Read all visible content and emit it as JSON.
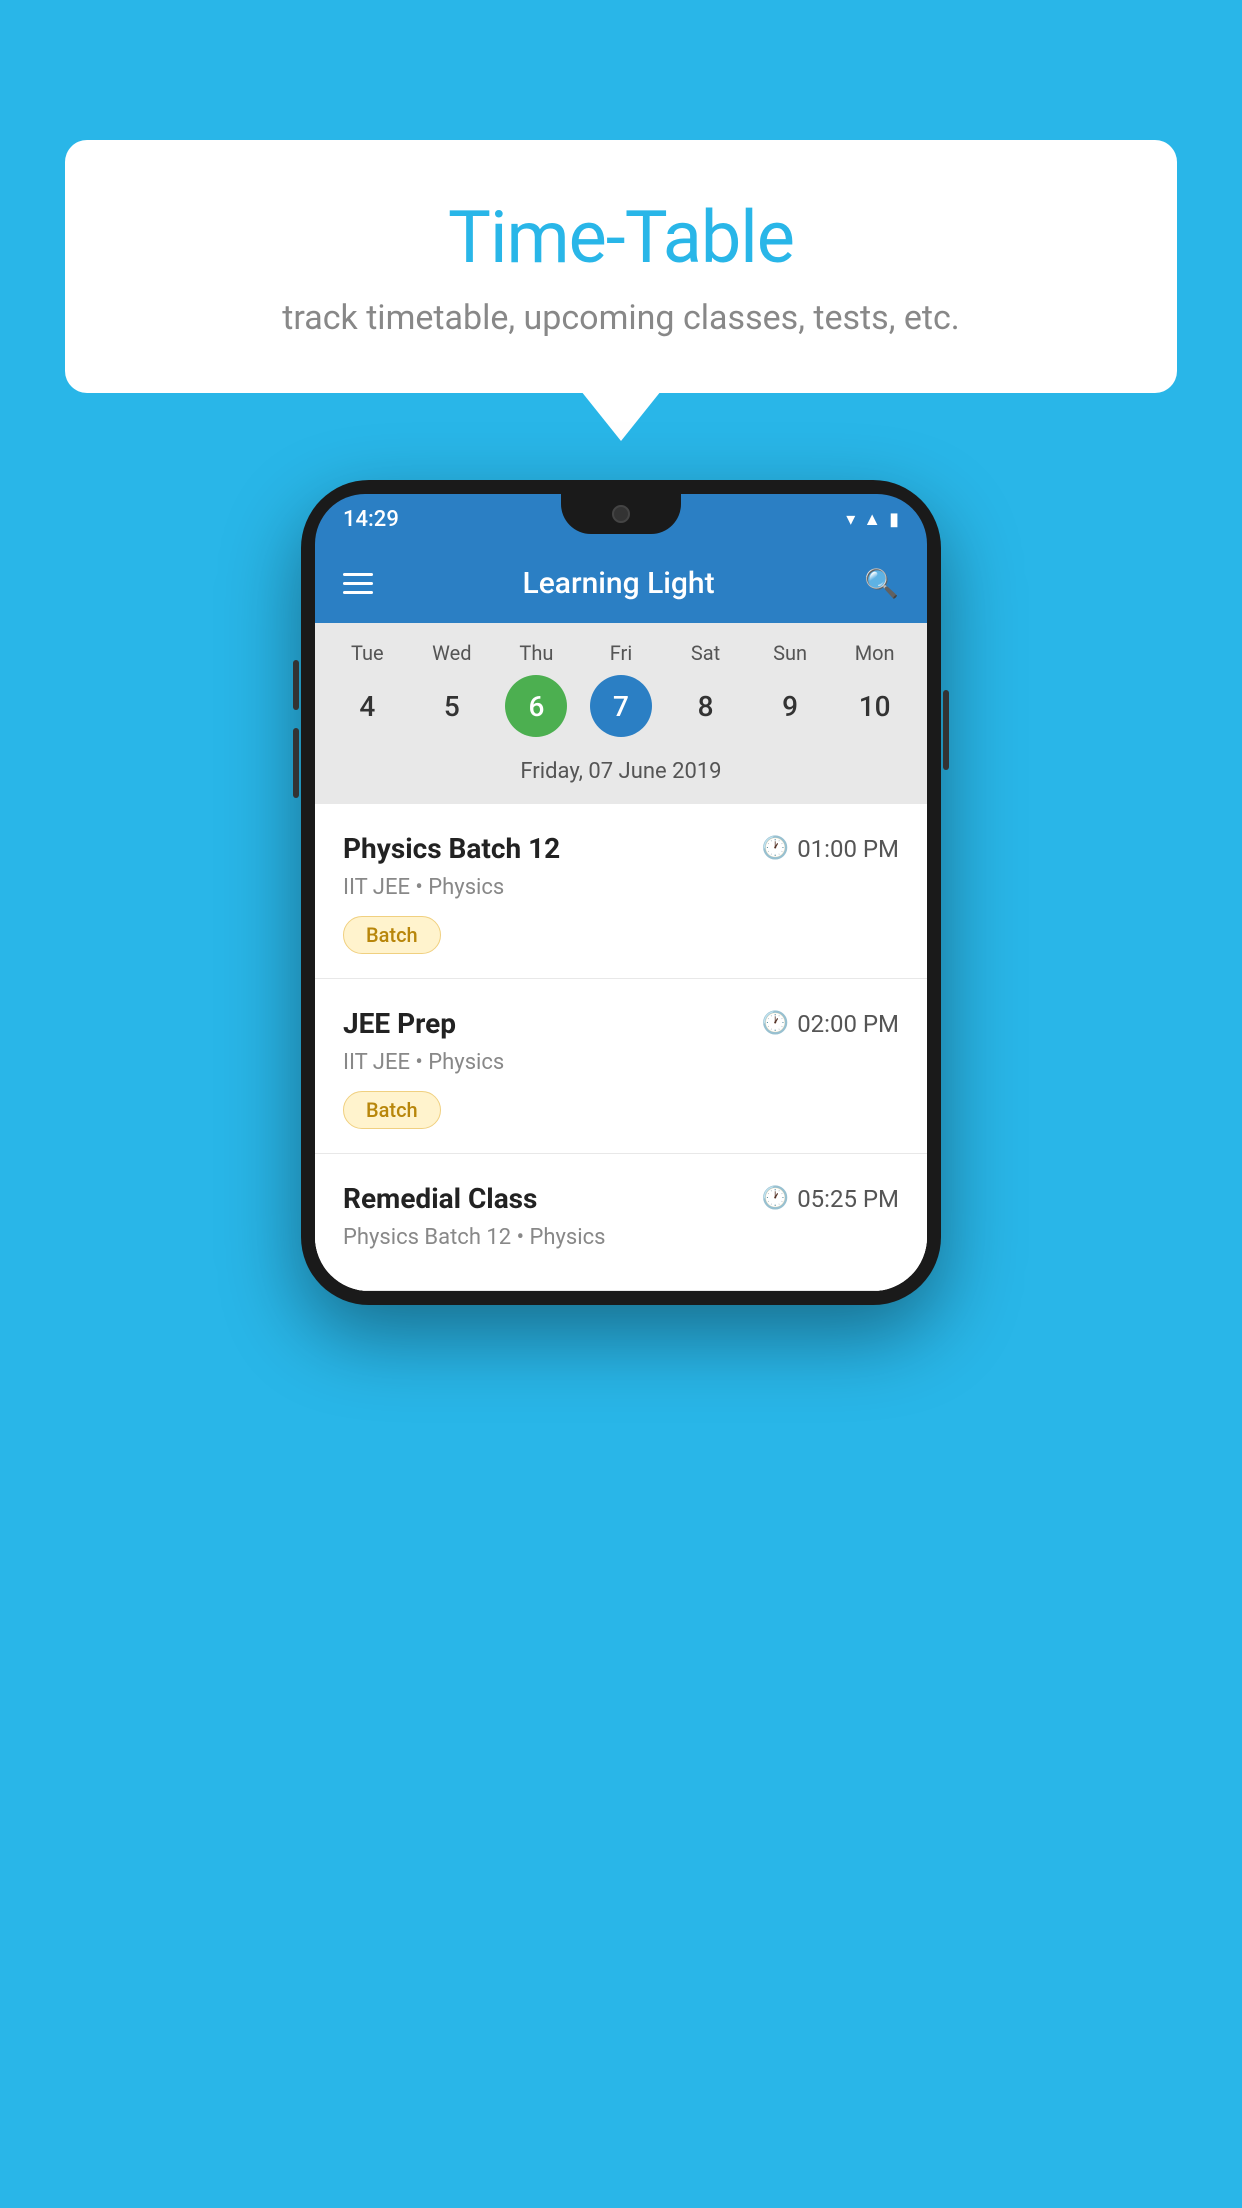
{
  "background_color": "#29b6e8",
  "speech_bubble": {
    "title": "Time-Table",
    "subtitle": "track timetable, upcoming classes, tests, etc."
  },
  "phone": {
    "status_bar": {
      "time": "14:29",
      "icons": [
        "wifi",
        "signal",
        "battery"
      ]
    },
    "app_header": {
      "title": "Learning Light"
    },
    "calendar": {
      "days": [
        {
          "label": "Tue",
          "number": "4"
        },
        {
          "label": "Wed",
          "number": "5"
        },
        {
          "label": "Thu",
          "number": "6",
          "state": "today"
        },
        {
          "label": "Fri",
          "number": "7",
          "state": "selected"
        },
        {
          "label": "Sat",
          "number": "8"
        },
        {
          "label": "Sun",
          "number": "9"
        },
        {
          "label": "Mon",
          "number": "10"
        }
      ],
      "selected_date_label": "Friday, 07 June 2019"
    },
    "schedule_items": [
      {
        "title": "Physics Batch 12",
        "time": "01:00 PM",
        "subtitle": "IIT JEE • Physics",
        "badge": "Batch"
      },
      {
        "title": "JEE Prep",
        "time": "02:00 PM",
        "subtitle": "IIT JEE • Physics",
        "badge": "Batch"
      },
      {
        "title": "Remedial Class",
        "time": "05:25 PM",
        "subtitle": "Physics Batch 12 • Physics",
        "badge": ""
      }
    ]
  }
}
